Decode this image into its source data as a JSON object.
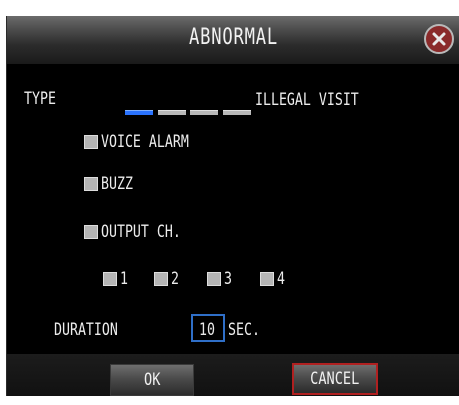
{
  "dialog": {
    "title": "ABNORMAL",
    "close_icon": "close-x-circle-icon"
  },
  "type_row": {
    "label": "TYPE",
    "selected_index": 0,
    "segment_count": 4,
    "value": "ILLEGAL VISIT"
  },
  "options": {
    "voice_alarm": {
      "label": "VOICE ALARM",
      "checked": false
    },
    "buzz": {
      "label": "BUZZ",
      "checked": false
    },
    "output_ch": {
      "label": "OUTPUT CH.",
      "checked": false
    }
  },
  "channels": [
    {
      "label": "1",
      "checked": false
    },
    {
      "label": "2",
      "checked": false
    },
    {
      "label": "3",
      "checked": false
    },
    {
      "label": "4",
      "checked": false
    }
  ],
  "duration": {
    "label": "DURATION",
    "value": "10",
    "unit": "SEC."
  },
  "buttons": {
    "ok": "OK",
    "cancel": "CANCEL"
  },
  "colors": {
    "accent": "#2a73ff",
    "focus_border": "#b02020",
    "background": "#000000"
  }
}
